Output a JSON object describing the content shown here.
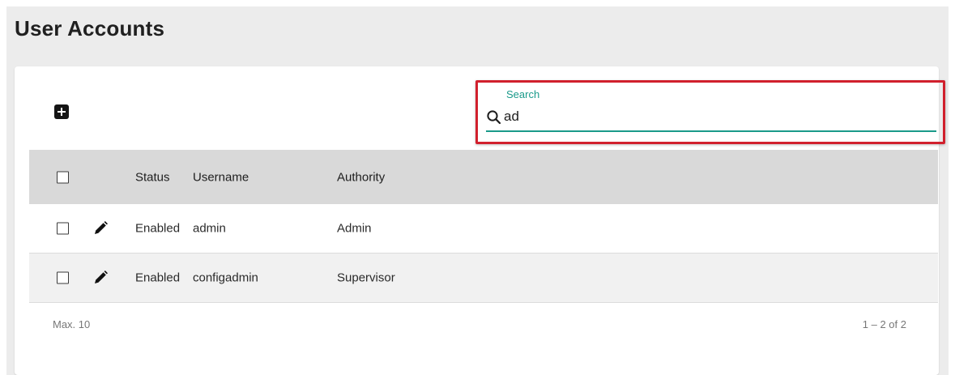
{
  "page": {
    "title": "User Accounts"
  },
  "toolbar": {
    "add_icon": "plus-square-icon"
  },
  "search": {
    "label": "Search",
    "value": "ad",
    "icon": "search-icon",
    "accent_color": "#1a9a8a",
    "highlight_color": "#d1202d"
  },
  "table": {
    "columns": [
      "Status",
      "Username",
      "Authority"
    ],
    "rows": [
      {
        "status": "Enabled",
        "username": "admin",
        "authority": "Admin"
      },
      {
        "status": "Enabled",
        "username": "configadmin",
        "authority": "Supervisor"
      }
    ]
  },
  "footer": {
    "max_label": "Max. 10",
    "pagination": "1 – 2 of 2"
  }
}
